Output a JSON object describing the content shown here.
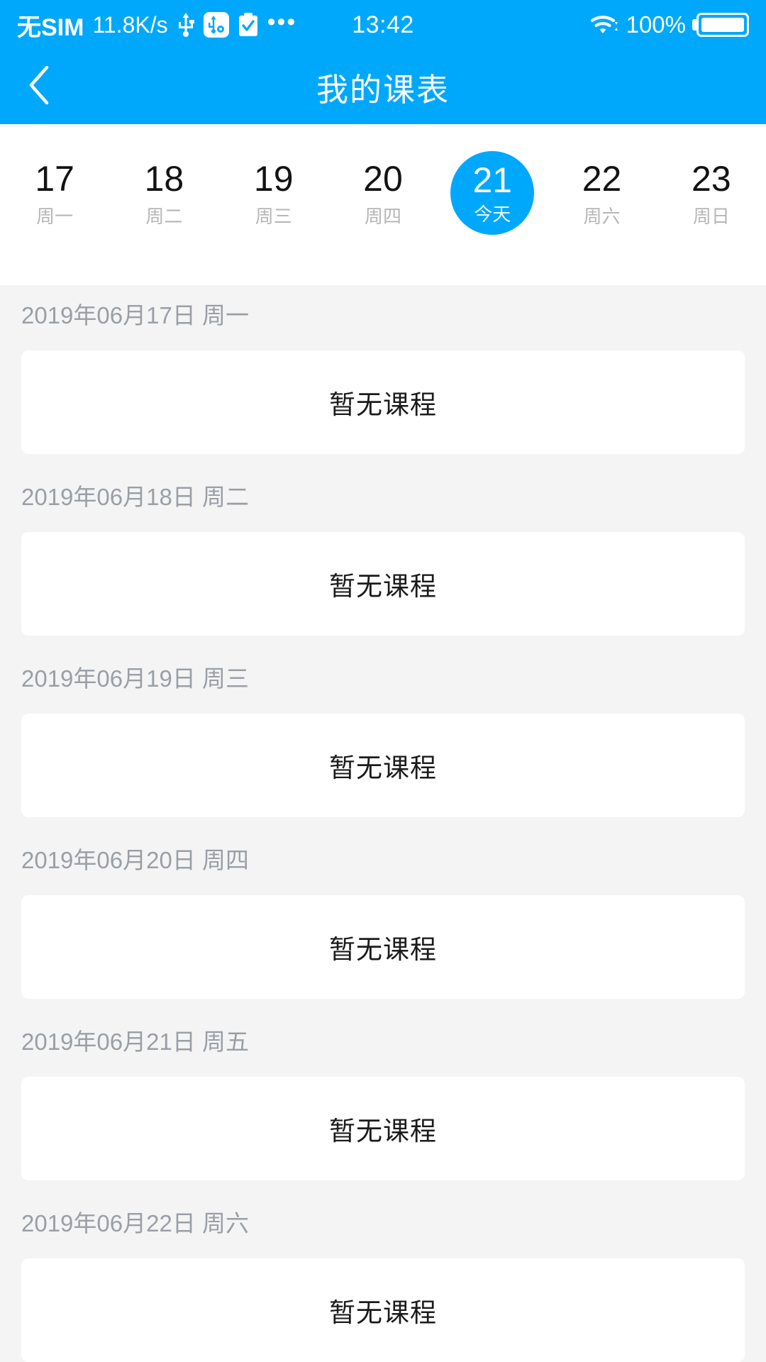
{
  "status_bar": {
    "carrier": "无SIM",
    "network_speed": "11.8K/s",
    "icons": [
      "usb-icon",
      "usb-debug-icon",
      "clipboard-check-icon",
      "more-dots-icon"
    ],
    "time": "13:42",
    "wifi": "wifi-icon",
    "battery_percent": "100%",
    "battery": "battery-full-icon"
  },
  "nav": {
    "back_icon": "chevron-left-icon",
    "title": "我的课表"
  },
  "week_strip": {
    "days": [
      {
        "num": "17",
        "weekday": "周一",
        "today": false
      },
      {
        "num": "18",
        "weekday": "周二",
        "today": false
      },
      {
        "num": "19",
        "weekday": "周三",
        "today": false
      },
      {
        "num": "20",
        "weekday": "周四",
        "today": false
      },
      {
        "num": "21",
        "weekday": "今天",
        "today": true
      },
      {
        "num": "22",
        "weekday": "周六",
        "today": false
      },
      {
        "num": "23",
        "weekday": "周日",
        "today": false
      }
    ]
  },
  "schedule": {
    "empty_label": "暂无课程",
    "days": [
      {
        "date_label": "2019年06月17日 周一",
        "empty_label": "暂无课程"
      },
      {
        "date_label": "2019年06月18日 周二",
        "empty_label": "暂无课程"
      },
      {
        "date_label": "2019年06月19日 周三",
        "empty_label": "暂无课程"
      },
      {
        "date_label": "2019年06月20日 周四",
        "empty_label": "暂无课程"
      },
      {
        "date_label": "2019年06月21日 周五",
        "empty_label": "暂无课程"
      },
      {
        "date_label": "2019年06月22日 周六",
        "empty_label": "暂无课程"
      }
    ]
  },
  "colors": {
    "accent": "#00a8fb",
    "page_bg": "#f4f4f4",
    "card_bg": "#ffffff",
    "muted_text": "#9a9fa6",
    "weekday_text": "#b6b6b6"
  }
}
